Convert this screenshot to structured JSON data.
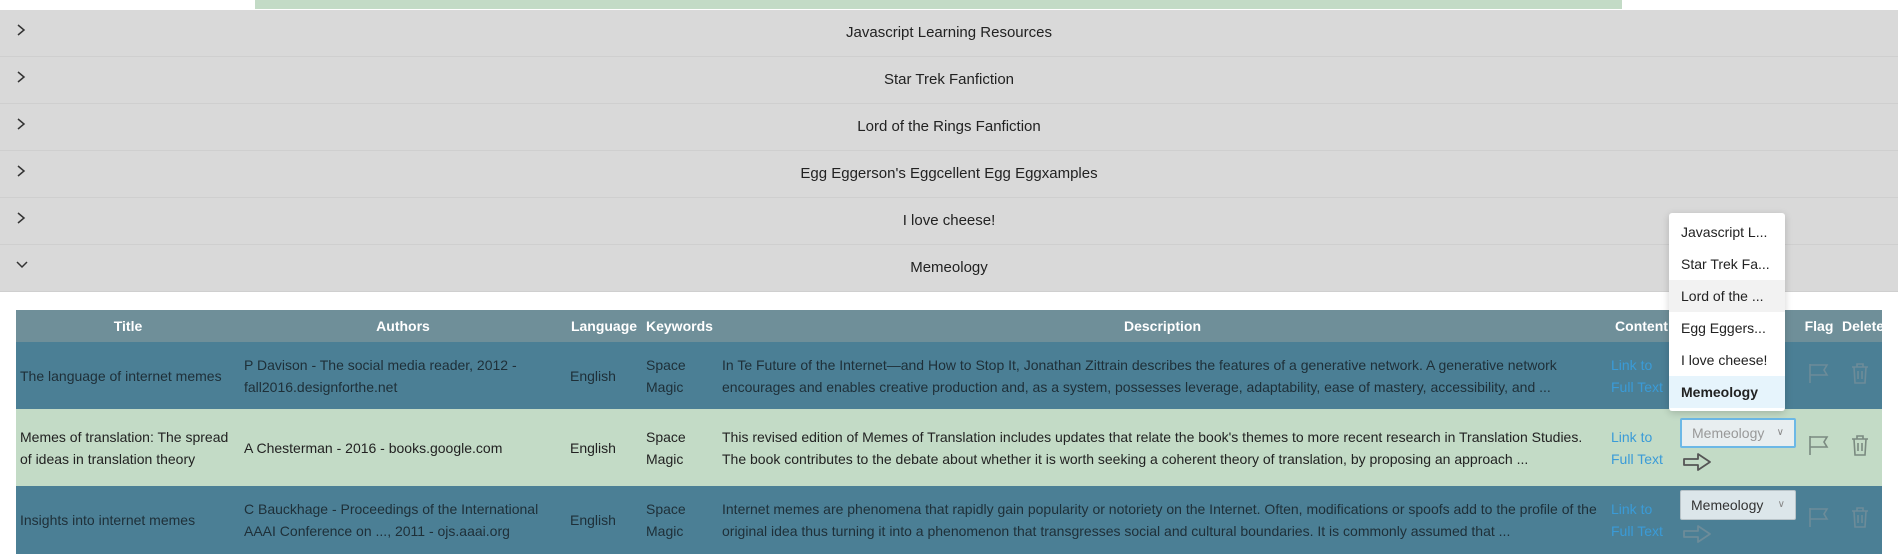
{
  "accordion": {
    "items": [
      {
        "label": "Javascript Learning Resources",
        "expanded": false
      },
      {
        "label": "Star Trek Fanfiction",
        "expanded": false
      },
      {
        "label": "Lord of the Rings Fanfiction",
        "expanded": false
      },
      {
        "label": "Egg Eggerson's Eggcellent Egg Eggxamples",
        "expanded": false
      },
      {
        "label": "I love cheese!",
        "expanded": false
      },
      {
        "label": "Memeology",
        "expanded": true
      }
    ]
  },
  "table": {
    "headers": {
      "title": "Title",
      "authors": "Authors",
      "language": "Language",
      "keywords": "Keywords",
      "description": "Description",
      "content": "Content",
      "flag": "Flag",
      "delete": "Delete"
    },
    "rows": [
      {
        "title": "The language of internet memes",
        "authors": "P Davison - The social media reader, 2012 - fall2016.designforthe.net",
        "language": "English",
        "keywords": "Space Magic",
        "description": "In Te Future of the Internet—and How to Stop It, Jonathan Zittrain describes the features of a generative network. A generative network encourages and enables creative production and, as a system, possesses leverage, adaptability, ease of mastery, accessibility, and ...",
        "content_link": "Link to Full Text",
        "category": "Memeology"
      },
      {
        "title": "Memes of translation: The spread of ideas in translation theory",
        "authors": "A Chesterman - 2016 - books.google.com",
        "language": "English",
        "keywords": "Space Magic",
        "description": "This revised edition of Memes of Translation includes updates that relate the book's themes to more recent research in Translation Studies. The book contributes to the debate about whether it is worth seeking a coherent theory of translation, by proposing an approach ...",
        "content_link": "Link to Full Text",
        "category": "Memeology"
      },
      {
        "title": "Insights into internet memes",
        "authors": "C Bauckhage - Proceedings of the International AAAI Conference on ..., 2011 - ojs.aaai.org",
        "language": "English",
        "keywords": "Space Magic",
        "description": "Internet memes are phenomena that rapidly gain popularity or notoriety on the Internet. Often, modifications or spoofs add to the profile of the original idea thus turning it into a phenomenon that transgresses social and cultural boundaries. It is commonly assumed that ...",
        "content_link": "Link to Full Text",
        "category": "Memeology"
      }
    ]
  },
  "dropdown": {
    "options": [
      "Javascript L...",
      "Star Trek Fa...",
      "Lord of the ...",
      "Egg Eggers...",
      "I love cheese!",
      "Memeology"
    ]
  },
  "colors": {
    "accordion_bg": "#d9d9d9",
    "header_bg": "#6f8f99",
    "row_dark": "#4b7f95",
    "row_light": "#c3dbc6",
    "link": "#3a9bd8"
  }
}
